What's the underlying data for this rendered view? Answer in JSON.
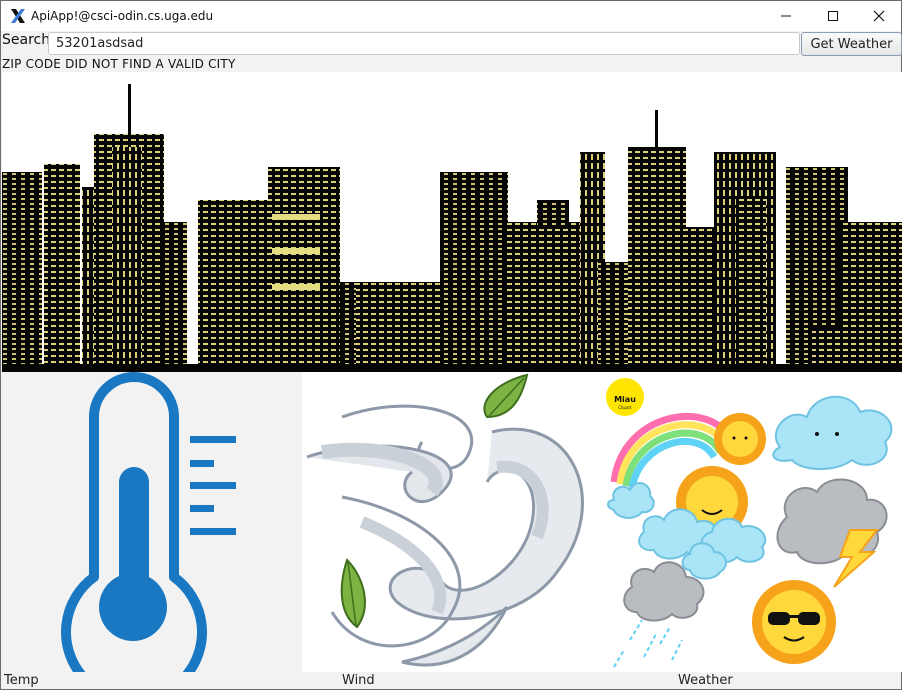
{
  "window": {
    "title": "ApiApp!@csci-odin.cs.uga.edu"
  },
  "search": {
    "label": "Search",
    "value": "53201asdsad",
    "button_label": "Get Weather"
  },
  "status": {
    "message": "ZIP CODE DID NOT FIND A VALID CITY"
  },
  "panels": {
    "temp_caption": "Temp",
    "wind_caption": "Wind",
    "weather_caption": "Weather"
  },
  "icons": {
    "app": "x-app-icon",
    "minimize": "minimize-icon",
    "maximize": "maximize-icon",
    "close": "close-icon"
  },
  "stickers": {
    "logo_text": "Miau",
    "logo_subtext": "Clipart"
  },
  "colors": {
    "thermometer": "#1a78c2",
    "leaf": "#7cb342",
    "window_lights": "#d9cf7a"
  }
}
